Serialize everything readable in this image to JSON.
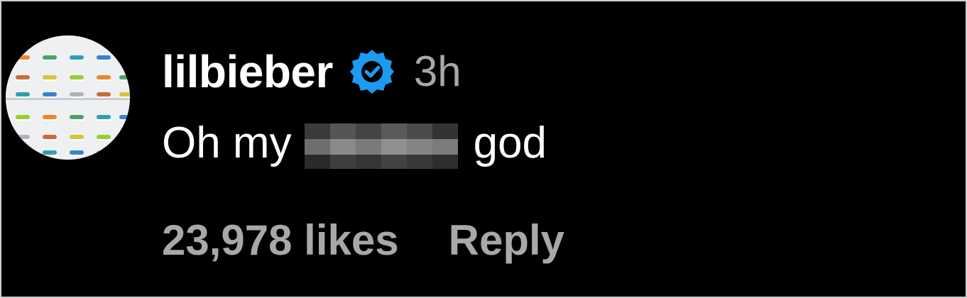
{
  "comment": {
    "author": {
      "username": "lilbieber",
      "verified": true,
      "avatar_icon": "avatar-image"
    },
    "time_ago": "3h",
    "text_before": "Oh my",
    "text_censored": "",
    "text_after": "god",
    "likes_label": "23,978 likes",
    "reply_label": "Reply"
  },
  "colors": {
    "background": "#000000",
    "primary_text": "#ffffff",
    "secondary_text": "#a8a8a8",
    "verified_badge": "#1d9bf0"
  }
}
